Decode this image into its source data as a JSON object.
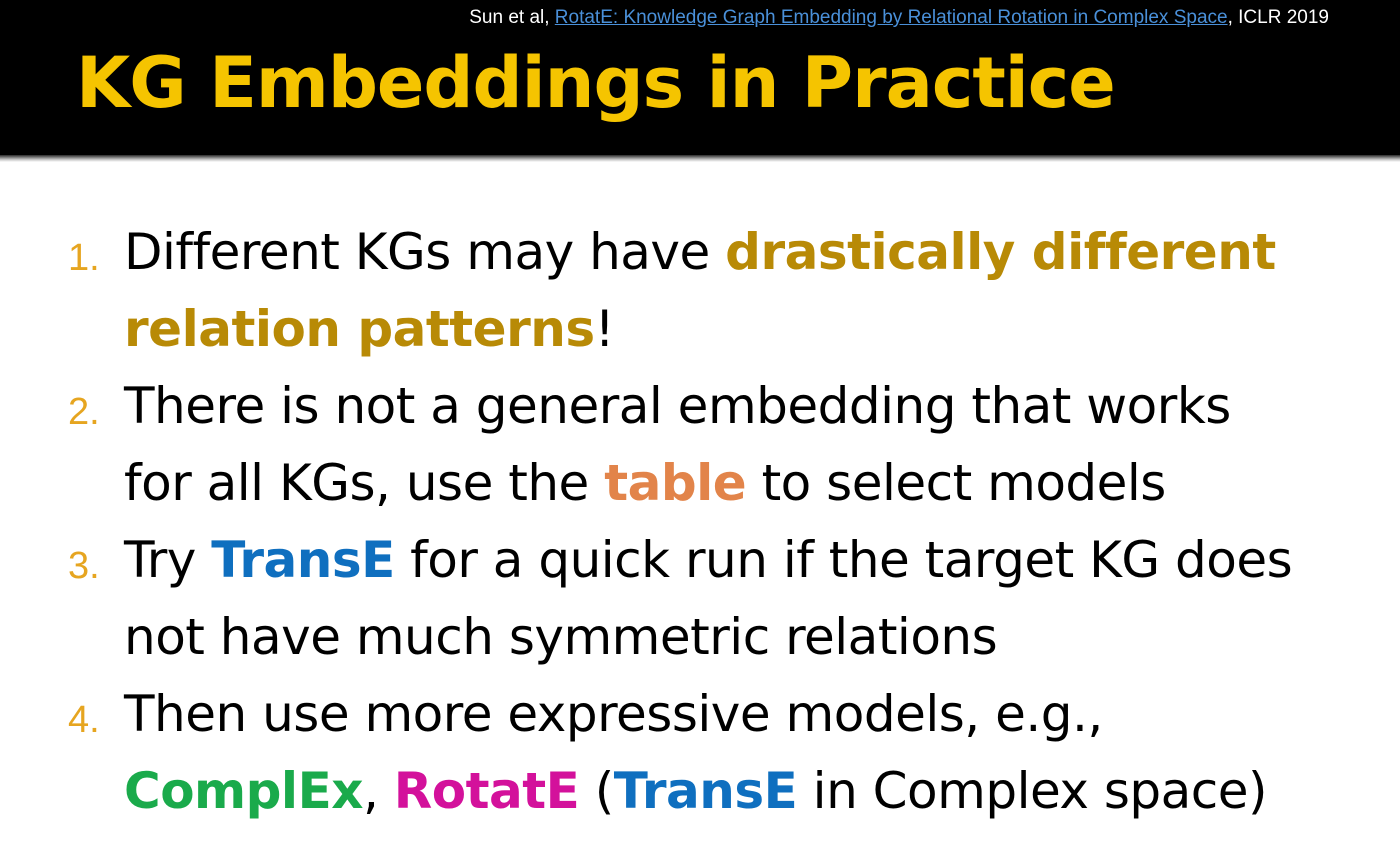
{
  "citation": {
    "prefix": "Sun et al, ",
    "link_text": "RotatE: Knowledge Graph Embedding by Relational Rotation in Complex Space",
    "suffix": ", ICLR 2019"
  },
  "title": "KG Embeddings in Practice",
  "items": [
    {
      "number": "1.",
      "line1": {
        "text": "Different KGs may have ",
        "emph": "drastically different"
      },
      "line2": {
        "emph": "relation patterns",
        "text": "!"
      }
    },
    {
      "number": "2.",
      "line1": {
        "text": "There is not a general embedding that works"
      },
      "line2": {
        "before": "for all KGs, use the ",
        "emph": "table",
        "after": " to select models"
      }
    },
    {
      "number": "3.",
      "line1": {
        "before": "Try ",
        "emph": "TransE",
        "after": " for a quick run if the target KG does"
      },
      "line2": {
        "text": "not have much symmetric relations"
      }
    },
    {
      "number": "4.",
      "line1": {
        "text": "Then use more expressive models, e.g.,"
      },
      "line2": {
        "complex": "ComplEx",
        "comma": ", ",
        "rotate": "RotatE",
        "paren_open": " (",
        "transe": "TransE",
        "rest": " in Complex space)"
      }
    }
  ],
  "colors": {
    "title": "#f5c400",
    "numbers": "#e6a520",
    "gold_emphasis": "#b88a06",
    "table_emphasis": "#e2844a",
    "transe": "#0f6fbf",
    "complex": "#1aaa4b",
    "rotate": "#d3119b"
  }
}
